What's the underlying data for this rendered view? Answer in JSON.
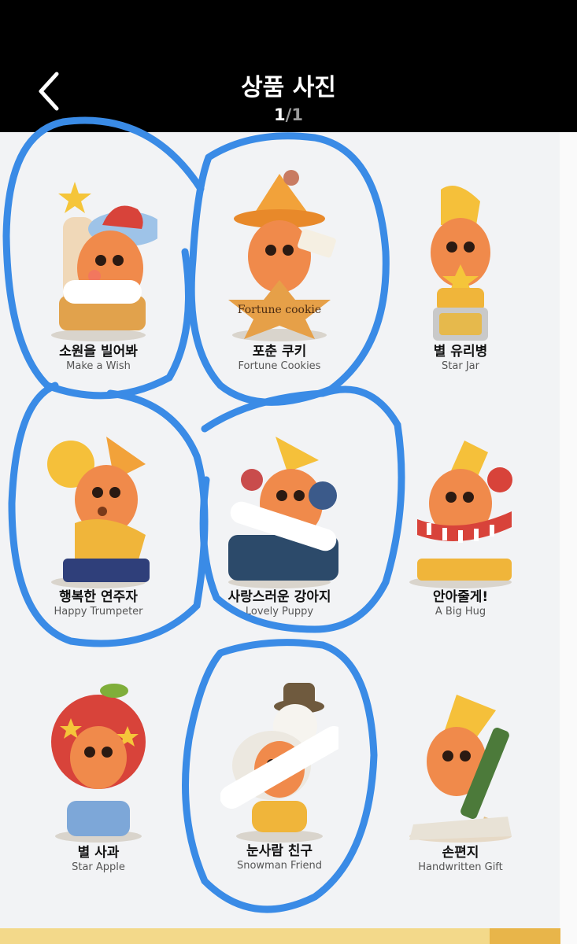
{
  "header": {
    "title": "상품 사진",
    "counter_current": "1",
    "counter_sep": "/",
    "counter_total": "1",
    "back_icon": "chevron-left-icon"
  },
  "products": [
    {
      "ko": "소원을 빌어봐",
      "en": "Make a Wish"
    },
    {
      "ko": "포춘 쿠키",
      "en": "Fortune Cookies"
    },
    {
      "ko": "별 유리병",
      "en": "Star Jar"
    },
    {
      "ko": "행복한 연주자",
      "en": "Happy Trumpeter"
    },
    {
      "ko": "사랑스러운 강아지",
      "en": "Lovely Puppy"
    },
    {
      "ko": "안아줄게!",
      "en": "A Big Hug"
    },
    {
      "ko": "별 사과",
      "en": "Star Apple"
    },
    {
      "ko": "눈사람 친구",
      "en": "Snowman Friend"
    },
    {
      "ko": "손편지",
      "en": "Handwritten Gift"
    }
  ],
  "figure_texts": {
    "fortune_cookie": "Fortune cookie"
  },
  "colors": {
    "background": "#000000",
    "photo_bg": "#f2f3f5",
    "annotation_blue": "#3a8be6",
    "figure_orange": "#f08a4b",
    "figure_yellow": "#f5c03a"
  }
}
